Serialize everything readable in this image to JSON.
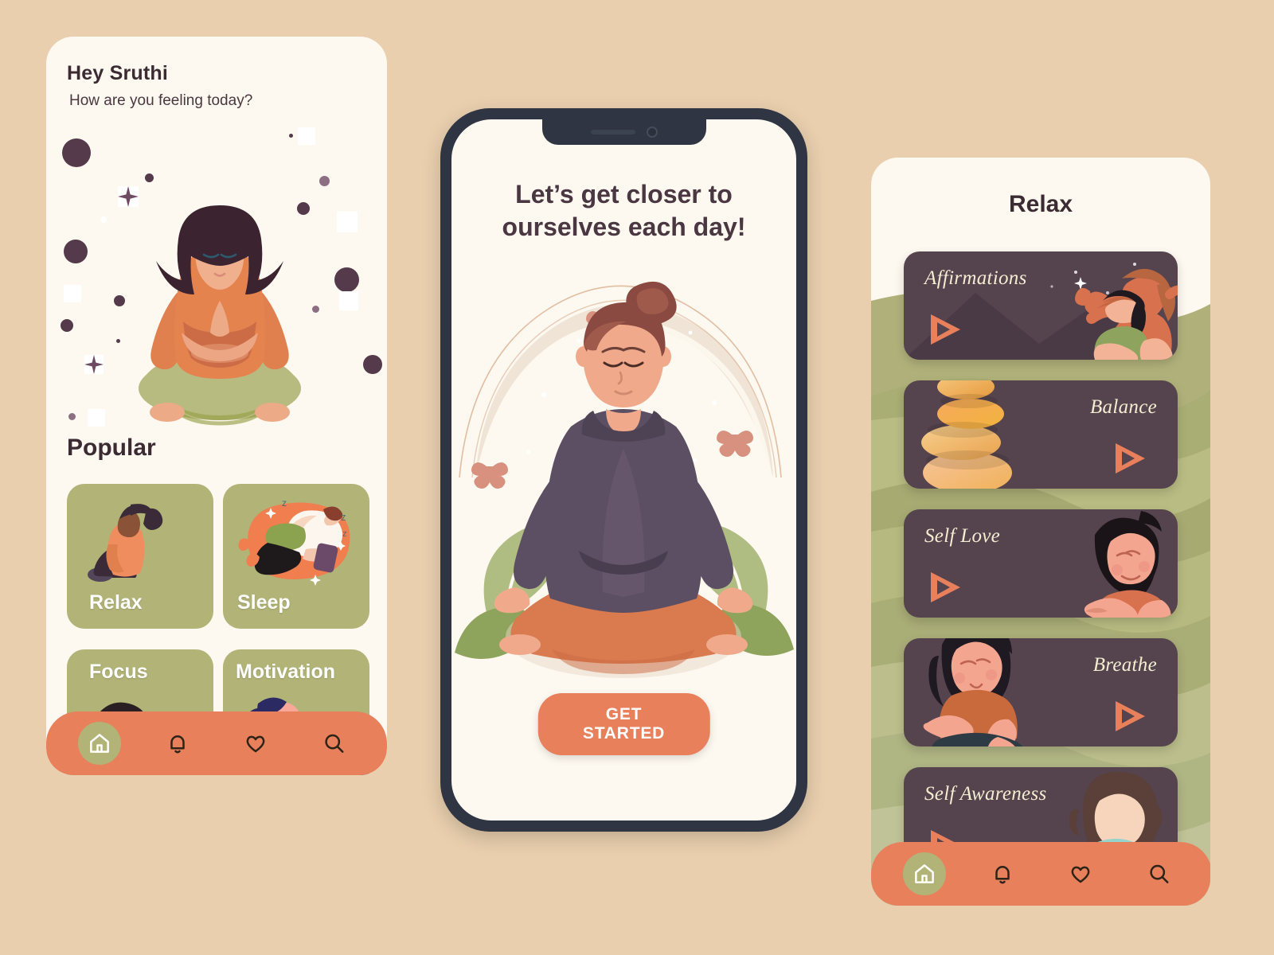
{
  "colors": {
    "page_bg": "#e9cfae",
    "screen_bg": "#fdf8f0",
    "accent_orange": "#e8805c",
    "card_green": "#b1b377",
    "dark_card": "#55434d",
    "text_dark": "#3c2b33",
    "device_frame": "#2f3542",
    "label_cream": "#f3edd2"
  },
  "home": {
    "greeting": "Hey Sruthi",
    "question": "How are you feeling today?",
    "section_title": "Popular",
    "hero_icon": "meditating-woman-illustration",
    "categories": [
      {
        "label": "Relax",
        "icon": "seated-stretch-illustration"
      },
      {
        "label": "Sleep",
        "icon": "sleeping-person-illustration"
      },
      {
        "label": "Focus",
        "icon": "thinking-man-illustration"
      },
      {
        "label": "Motivation",
        "icon": "running-woman-illustration"
      }
    ],
    "nav": [
      {
        "label": "Home",
        "icon": "home-icon",
        "active": true
      },
      {
        "label": "Notifications",
        "icon": "bell-icon",
        "active": false
      },
      {
        "label": "Favorites",
        "icon": "heart-icon",
        "active": false
      },
      {
        "label": "Search",
        "icon": "search-icon",
        "active": false
      }
    ]
  },
  "onboarding": {
    "headline": "Let’s get closer to ourselves each day!",
    "cta_label": "GET STARTED",
    "hero_icon": "lotus-meditation-illustration",
    "notch_icons": [
      "speaker-grille-icon",
      "front-camera-icon"
    ]
  },
  "relax": {
    "title": "Relax",
    "items": [
      {
        "label": "Affirmations",
        "align": "left",
        "icon": "strong-women-illustration",
        "play_icon": "play-icon"
      },
      {
        "label": "Balance",
        "align": "right",
        "icon": "stacked-stones-illustration",
        "play_icon": "play-icon"
      },
      {
        "label": "Self Love",
        "align": "left",
        "icon": "self-hug-illustration",
        "play_icon": "play-icon"
      },
      {
        "label": "Breathe",
        "align": "right",
        "icon": "breathing-woman-illustration",
        "play_icon": "play-icon"
      },
      {
        "label": "Self Awareness",
        "align": "left",
        "icon": "curly-hair-woman-illustration",
        "play_icon": "play-icon"
      }
    ],
    "nav": [
      {
        "label": "Home",
        "icon": "home-icon",
        "active": true
      },
      {
        "label": "Notifications",
        "icon": "bell-icon",
        "active": false
      },
      {
        "label": "Favorites",
        "icon": "heart-icon",
        "active": false
      },
      {
        "label": "Search",
        "icon": "search-icon",
        "active": false
      }
    ]
  }
}
